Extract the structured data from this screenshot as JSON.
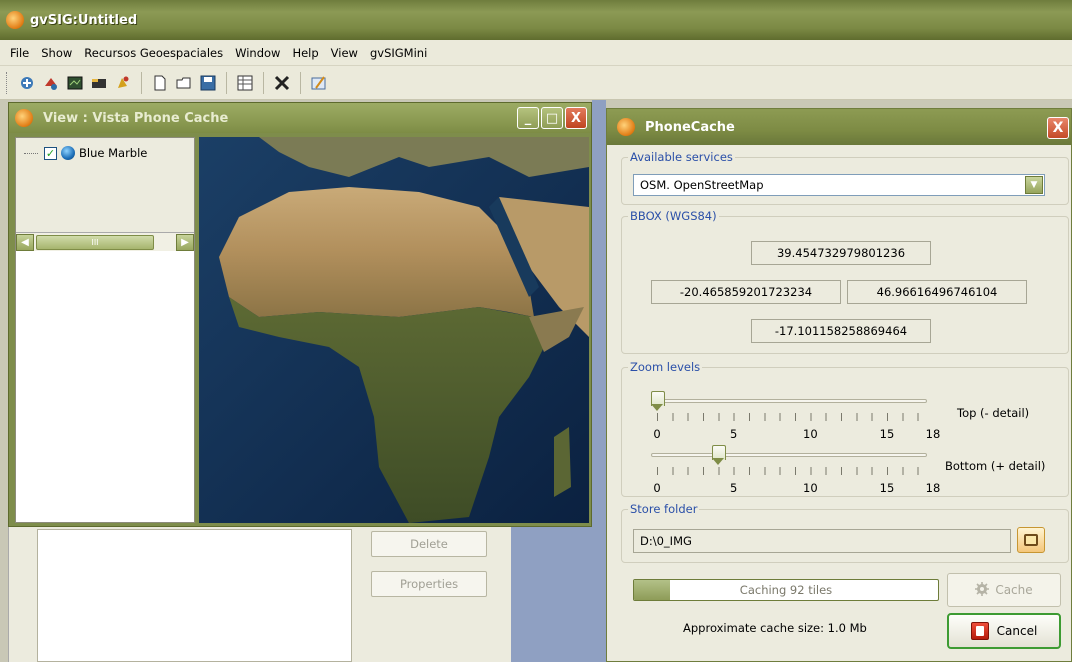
{
  "app": {
    "title": "gvSIG:Untitled"
  },
  "menu": [
    "File",
    "Show",
    "Recursos Geoespaciales",
    "Window",
    "Help",
    "View",
    "gvSIGMini"
  ],
  "toolbar": {
    "icons": [
      "add-layer-icon",
      "layer-props-icon",
      "map-icon",
      "folder-icon",
      "pointer-icon",
      "new-document-icon",
      "open-folder-icon",
      "save-icon",
      "table-icon",
      "tools-icon",
      "edit-layer-icon"
    ]
  },
  "view": {
    "title": "View : Vista Phone Cache",
    "layer": {
      "name": "Blue Marble",
      "checked": true
    },
    "window_buttons": {
      "minimize": "_",
      "maximize": "□",
      "close": "X"
    }
  },
  "background_panel": {
    "delete_label": "Delete",
    "properties_label": "Properties"
  },
  "dialog": {
    "title": "PhoneCache",
    "close": "X",
    "services": {
      "legend": "Available services",
      "selected": "OSM. OpenStreetMap"
    },
    "bbox": {
      "legend": "BBOX (WGS84)",
      "north": "39.454732979801236",
      "west": "-20.465859201723234",
      "east": "46.96616496746104",
      "south": "-17.101158258869464"
    },
    "zoom": {
      "legend": "Zoom levels",
      "min": 0,
      "max": 18,
      "tick_labels": [
        "0",
        "5",
        "10",
        "15",
        "18"
      ],
      "top": {
        "value": 0,
        "label": "Top (- detail)"
      },
      "bottom": {
        "value": 4,
        "label": "Bottom (+ detail)"
      }
    },
    "store": {
      "legend": "Store folder",
      "path": "D:\\0_IMG"
    },
    "progress": {
      "text": "Caching 92 tiles",
      "fraction": 0.12
    },
    "cache_button": "Cache",
    "cache_size": "Approximate cache size: 1.0 Mb",
    "cancel_button": "Cancel"
  },
  "colors": {
    "accent": "#7c8a45",
    "legend_text": "#2a4fa8"
  }
}
